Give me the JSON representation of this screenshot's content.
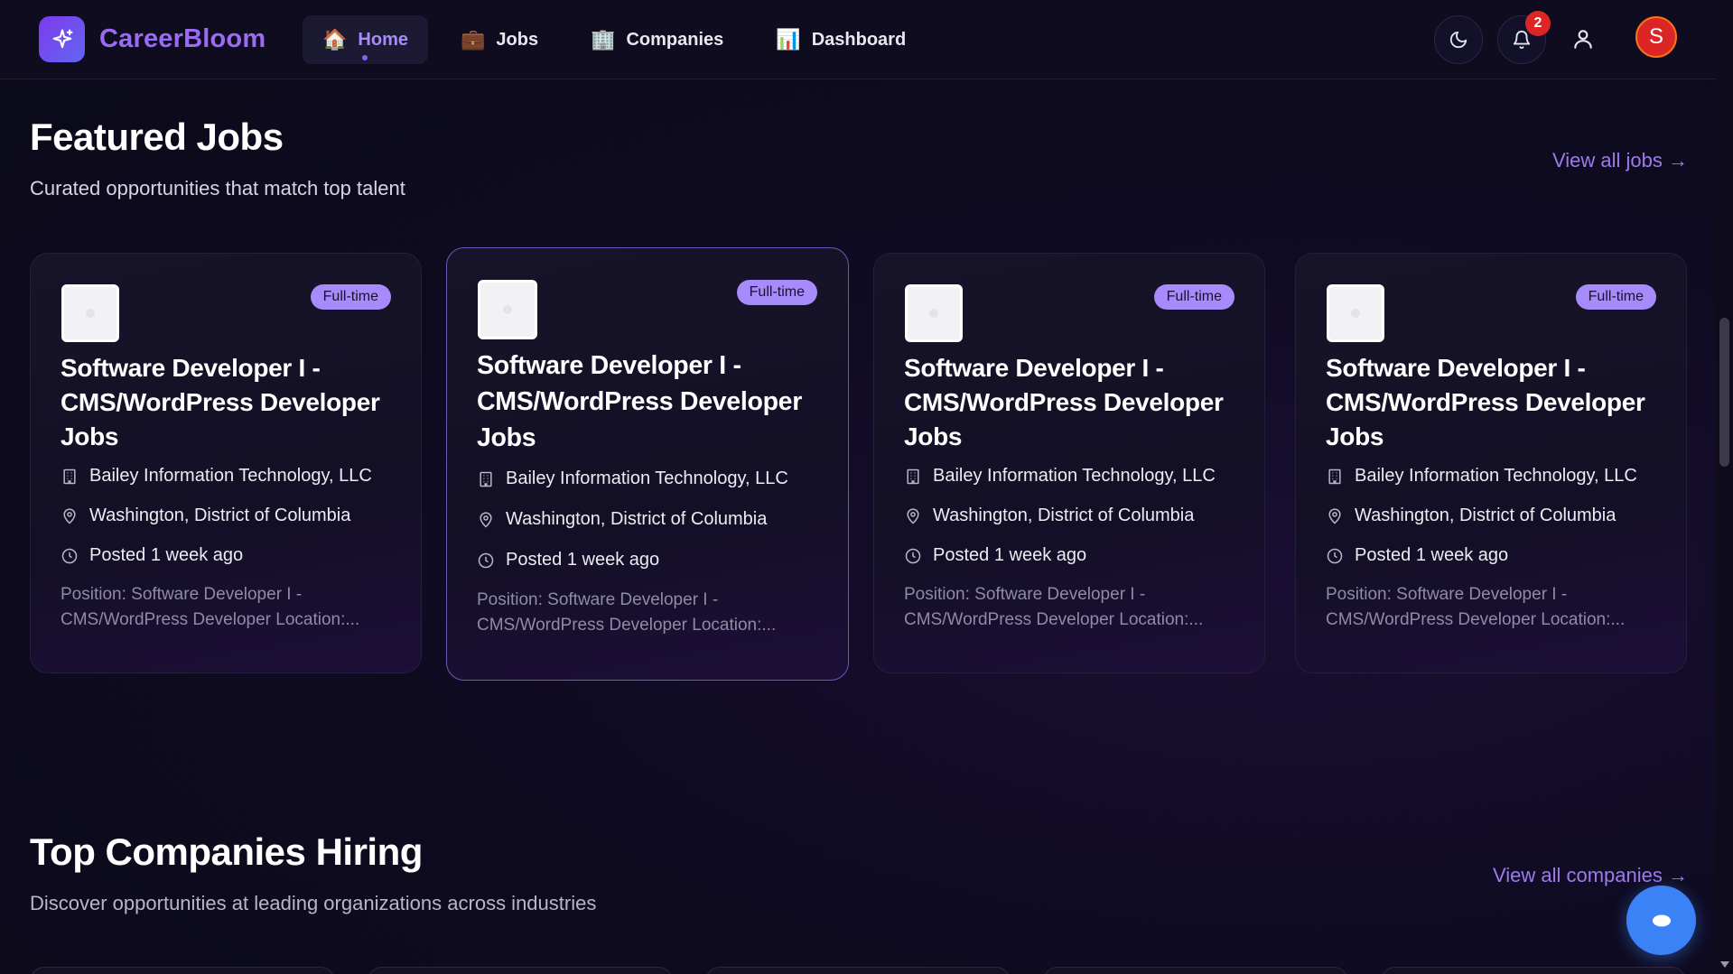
{
  "brand": {
    "name": "CareerBloom",
    "icon": "sparkle-icon"
  },
  "nav": {
    "items": [
      {
        "label": "Home",
        "emoji": "🏠",
        "active": true
      },
      {
        "label": "Jobs",
        "emoji": "💼",
        "active": false
      },
      {
        "label": "Companies",
        "emoji": "🏢",
        "active": false
      },
      {
        "label": "Dashboard",
        "emoji": "📊",
        "active": false
      }
    ],
    "notifications_count": "2",
    "avatar_initial": "S"
  },
  "featured": {
    "title": "Featured Jobs",
    "subtitle": "Curated opportunities that match top talent",
    "view_all": "View all jobs →",
    "jobs": [
      {
        "type": "Full-time",
        "title": "Software Developer I - CMS/WordPress Developer Jobs",
        "company": "Bailey Information Technology, LLC",
        "location": "Washington, District of Columbia",
        "posted": "Posted 1 week ago",
        "description": "Position: Software Developer I - CMS/WordPress Developer Location:..."
      },
      {
        "type": "Full-time",
        "title": "Software Developer I - CMS/WordPress Developer Jobs",
        "company": "Bailey Information Technology, LLC",
        "location": "Washington, District of Columbia",
        "posted": "Posted 1 week ago",
        "description": "Position: Software Developer I - CMS/WordPress Developer Location:..."
      },
      {
        "type": "Full-time",
        "title": "Software Developer I - CMS/WordPress Developer Jobs",
        "company": "Bailey Information Technology, LLC",
        "location": "Washington, District of Columbia",
        "posted": "Posted 1 week ago",
        "description": "Position: Software Developer I - CMS/WordPress Developer Location:..."
      },
      {
        "type": "Full-time",
        "title": "Software Developer I - CMS/WordPress Developer Jobs",
        "company": "Bailey Information Technology, LLC",
        "location": "Washington, District of Columbia",
        "posted": "Posted 1 week ago",
        "description": "Position: Software Developer I - CMS/WordPress Developer Location:..."
      }
    ]
  },
  "companies": {
    "title": "Top Companies Hiring",
    "subtitle": "Discover opportunities at leading organizations across industries",
    "view_all": "View all companies →"
  },
  "colors": {
    "accent": "#9b6bf5",
    "tag_bg": "#a78bfa",
    "badge": "#dc2626",
    "chat_button": "#3b82f6"
  }
}
